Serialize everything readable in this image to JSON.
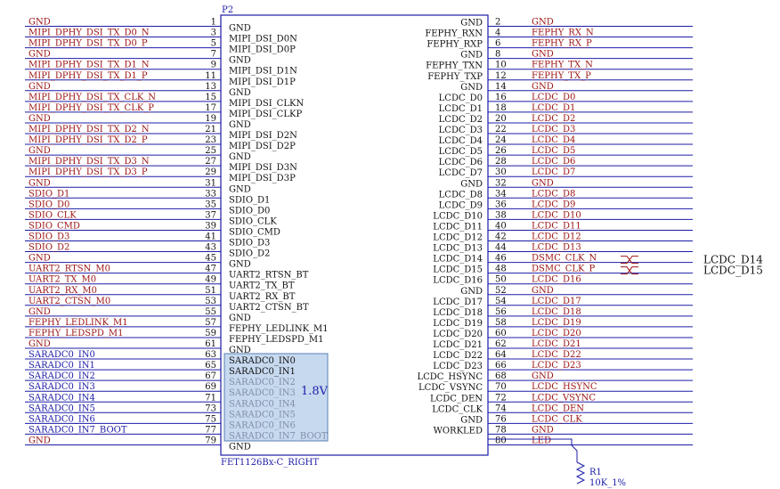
{
  "component": {
    "designator": "P2",
    "part_name": "FET1126Bx-C_RIGHT",
    "voltage_label": "1.8V"
  },
  "colors": {
    "wire": "#1c1ca8",
    "body": "#1c1ca8",
    "net_red": "#9b1414",
    "net_blue": "#1c1ca8",
    "pin_text": "#111111",
    "pin_text_gray": "#7f8fa6",
    "highlight_fill": "#c7d9ef",
    "highlight_stroke": "#5a7fb5"
  },
  "left_pins": [
    {
      "num": "1",
      "pin": "GND",
      "net": "GND",
      "net_color": "red"
    },
    {
      "num": "3",
      "pin": "MIPI_DSI_D0N",
      "net": "MIPI_DPHY_DSI_TX_D0_N",
      "net_color": "red"
    },
    {
      "num": "5",
      "pin": "MIPI_DSI_D0P",
      "net": "MIPI_DPHY_DSI_TX_D0_P",
      "net_color": "red"
    },
    {
      "num": "7",
      "pin": "GND",
      "net": "GND",
      "net_color": "red"
    },
    {
      "num": "9",
      "pin": "MIPI_DSI_D1N",
      "net": "MIPI_DPHY_DSI_TX_D1_N",
      "net_color": "red"
    },
    {
      "num": "11",
      "pin": "MIPI_DSI_D1P",
      "net": "MIPI_DPHY_DSI_TX_D1_P",
      "net_color": "red"
    },
    {
      "num": "13",
      "pin": "GND",
      "net": "GND",
      "net_color": "red"
    },
    {
      "num": "15",
      "pin": "MIPI_DSI_CLKN",
      "net": "MIPI_DPHY_DSI_TX_CLK_N",
      "net_color": "red"
    },
    {
      "num": "17",
      "pin": "MIPI_DSI_CLKP",
      "net": "MIPI_DPHY_DSI_TX_CLK_P",
      "net_color": "red"
    },
    {
      "num": "19",
      "pin": "GND",
      "net": "GND",
      "net_color": "red"
    },
    {
      "num": "21",
      "pin": "MIPI_DSI_D2N",
      "net": "MIPI_DPHY_DSI_TX_D2_N",
      "net_color": "red"
    },
    {
      "num": "23",
      "pin": "MIPI_DSI_D2P",
      "net": "MIPI_DPHY_DSI_TX_D2_P",
      "net_color": "red"
    },
    {
      "num": "25",
      "pin": "GND",
      "net": "GND",
      "net_color": "red"
    },
    {
      "num": "27",
      "pin": "MIPI_DSI_D3N",
      "net": "MIPI_DPHY_DSI_TX_D3_N",
      "net_color": "red"
    },
    {
      "num": "29",
      "pin": "MIPI_DSI_D3P",
      "net": "MIPI_DPHY_DSI_TX_D3_P",
      "net_color": "red"
    },
    {
      "num": "31",
      "pin": "GND",
      "net": "GND",
      "net_color": "red"
    },
    {
      "num": "33",
      "pin": "SDIO_D1",
      "net": "SDIO_D1",
      "net_color": "red"
    },
    {
      "num": "35",
      "pin": "SDIO_D0",
      "net": "SDIO_D0",
      "net_color": "red"
    },
    {
      "num": "37",
      "pin": "SDIO_CLK",
      "net": "SDIO_CLK",
      "net_color": "red"
    },
    {
      "num": "39",
      "pin": "SDIO_CMD",
      "net": "SDIO_CMD",
      "net_color": "red"
    },
    {
      "num": "41",
      "pin": "SDIO_D3",
      "net": "SDIO_D3",
      "net_color": "red"
    },
    {
      "num": "43",
      "pin": "SDIO_D2",
      "net": "SDIO_D2",
      "net_color": "red"
    },
    {
      "num": "45",
      "pin": "GND",
      "net": "GND",
      "net_color": "red"
    },
    {
      "num": "47",
      "pin": "UART2_RTSN_BT",
      "net": "UART2_RTSN_M0",
      "net_color": "red"
    },
    {
      "num": "49",
      "pin": "UART2_TX_BT",
      "net": "UART2_TX_M0",
      "net_color": "red"
    },
    {
      "num": "51",
      "pin": "UART2_RX_BT",
      "net": "UART2_RX_M0",
      "net_color": "red"
    },
    {
      "num": "53",
      "pin": "UART2_CTSN_BT",
      "net": "UART2_CTSN_M0",
      "net_color": "red"
    },
    {
      "num": "55",
      "pin": "GND",
      "net": "GND",
      "net_color": "red"
    },
    {
      "num": "57",
      "pin": "FEPHY_LEDLINK_M1",
      "net": "FEPHY_LEDLINK_M1",
      "net_color": "red"
    },
    {
      "num": "59",
      "pin": "FEPHY_LEDSPD_M1",
      "net": "FEPHY_LEDSPD_M1",
      "net_color": "red"
    },
    {
      "num": "61",
      "pin": "GND",
      "net": "GND",
      "net_color": "red"
    },
    {
      "num": "63",
      "pin": "SARADC0_IN0",
      "net": "SARADC0_IN0",
      "net_color": "blue",
      "gray": false
    },
    {
      "num": "65",
      "pin": "SARADC0_IN1",
      "net": "SARADC0_IN1",
      "net_color": "blue",
      "gray": false
    },
    {
      "num": "67",
      "pin": "SARADC0_IN2",
      "net": "SARADC0_IN2",
      "net_color": "blue",
      "gray": true
    },
    {
      "num": "69",
      "pin": "SARADC0_IN3",
      "net": "SARADC0_IN3",
      "net_color": "blue",
      "gray": true
    },
    {
      "num": "71",
      "pin": "SARADC0_IN4",
      "net": "SARADC0_IN4",
      "net_color": "blue",
      "gray": true
    },
    {
      "num": "73",
      "pin": "SARADC0_IN5",
      "net": "SARADC0_IN5",
      "net_color": "blue",
      "gray": true
    },
    {
      "num": "75",
      "pin": "SARADC0_IN6",
      "net": "SARADC0_IN6",
      "net_color": "blue",
      "gray": true
    },
    {
      "num": "77",
      "pin": "SARADC0_IN7_BOOT",
      "net": "SARADC0_IN7_BOOT",
      "net_color": "blue",
      "gray": true
    },
    {
      "num": "79",
      "pin": "GND",
      "net": "GND",
      "net_color": "red"
    }
  ],
  "right_pins": [
    {
      "num": "2",
      "pin": "GND",
      "net": "GND"
    },
    {
      "num": "4",
      "pin": "FEPHY_RXN",
      "net": "FEPHY_RX_N"
    },
    {
      "num": "6",
      "pin": "FEPHY_RXP",
      "net": "FEPHY_RX_P"
    },
    {
      "num": "8",
      "pin": "GND",
      "net": "GND"
    },
    {
      "num": "10",
      "pin": "FEPHY_TXN",
      "net": "FEPHY_TX_N"
    },
    {
      "num": "12",
      "pin": "FEPHY_TXP",
      "net": "FEPHY_TX_P"
    },
    {
      "num": "14",
      "pin": "GND",
      "net": "GND"
    },
    {
      "num": "16",
      "pin": "LCDC_D0",
      "net": "LCDC_D0"
    },
    {
      "num": "18",
      "pin": "LCDC_D1",
      "net": "LCDC_D1"
    },
    {
      "num": "20",
      "pin": "LCDC_D2",
      "net": "LCDC_D2"
    },
    {
      "num": "22",
      "pin": "LCDC_D3",
      "net": "LCDC_D3"
    },
    {
      "num": "24",
      "pin": "LCDC_D4",
      "net": "LCDC_D4"
    },
    {
      "num": "26",
      "pin": "LCDC_D5",
      "net": "LCDC_D5"
    },
    {
      "num": "28",
      "pin": "LCDC_D6",
      "net": "LCDC_D6"
    },
    {
      "num": "30",
      "pin": "LCDC_D7",
      "net": "LCDC_D7"
    },
    {
      "num": "32",
      "pin": "GND",
      "net": "GND"
    },
    {
      "num": "34",
      "pin": "LCDC_D8",
      "net": "LCDC_D8"
    },
    {
      "num": "36",
      "pin": "LCDC_D9",
      "net": "LCDC_D9"
    },
    {
      "num": "38",
      "pin": "LCDC_D10",
      "net": "LCDC_D10"
    },
    {
      "num": "40",
      "pin": "LCDC_D11",
      "net": "LCDC_D11"
    },
    {
      "num": "42",
      "pin": "LCDC_D12",
      "net": "LCDC_D12"
    },
    {
      "num": "44",
      "pin": "LCDC_D13",
      "net": "LCDC_D13"
    },
    {
      "num": "46",
      "pin": "LCDC_D14",
      "net": "DSMC_CLK_N",
      "alias": "LCDC_D14"
    },
    {
      "num": "48",
      "pin": "LCDC_D15",
      "net": "DSMC_CLK_P",
      "alias": "LCDC_D15"
    },
    {
      "num": "50",
      "pin": "LCDC_D16",
      "net": "LCDC_D16"
    },
    {
      "num": "52",
      "pin": "GND",
      "net": "GND"
    },
    {
      "num": "54",
      "pin": "LCDC_D17",
      "net": "LCDC_D17"
    },
    {
      "num": "56",
      "pin": "LCDC_D18",
      "net": "LCDC_D18"
    },
    {
      "num": "58",
      "pin": "LCDC_D19",
      "net": "LCDC_D19"
    },
    {
      "num": "60",
      "pin": "LCDC_D20",
      "net": "LCDC_D20"
    },
    {
      "num": "62",
      "pin": "LCDC_D21",
      "net": "LCDC_D21"
    },
    {
      "num": "64",
      "pin": "LCDC_D22",
      "net": "LCDC_D22"
    },
    {
      "num": "66",
      "pin": "LCDC_D23",
      "net": "LCDC_D23"
    },
    {
      "num": "68",
      "pin": "LCDC_HSYNC",
      "net": "GND"
    },
    {
      "num": "70",
      "pin": "LCDC_VSYNC",
      "net": "LCDC_HSYNC"
    },
    {
      "num": "72",
      "pin": "LCDC_DEN",
      "net": "LCDC_VSYNC"
    },
    {
      "num": "74",
      "pin": "LCDC_CLK",
      "net": "LCDC_DEN"
    },
    {
      "num": "76",
      "pin": "GND",
      "net": "LCDC_CLK"
    },
    {
      "num": "78",
      "pin": "WORKLED",
      "net": "GND"
    },
    {
      "num": "80",
      "pin": "",
      "net": "LED"
    }
  ],
  "resistor": {
    "designator": "R1",
    "value": "10K_1%"
  }
}
